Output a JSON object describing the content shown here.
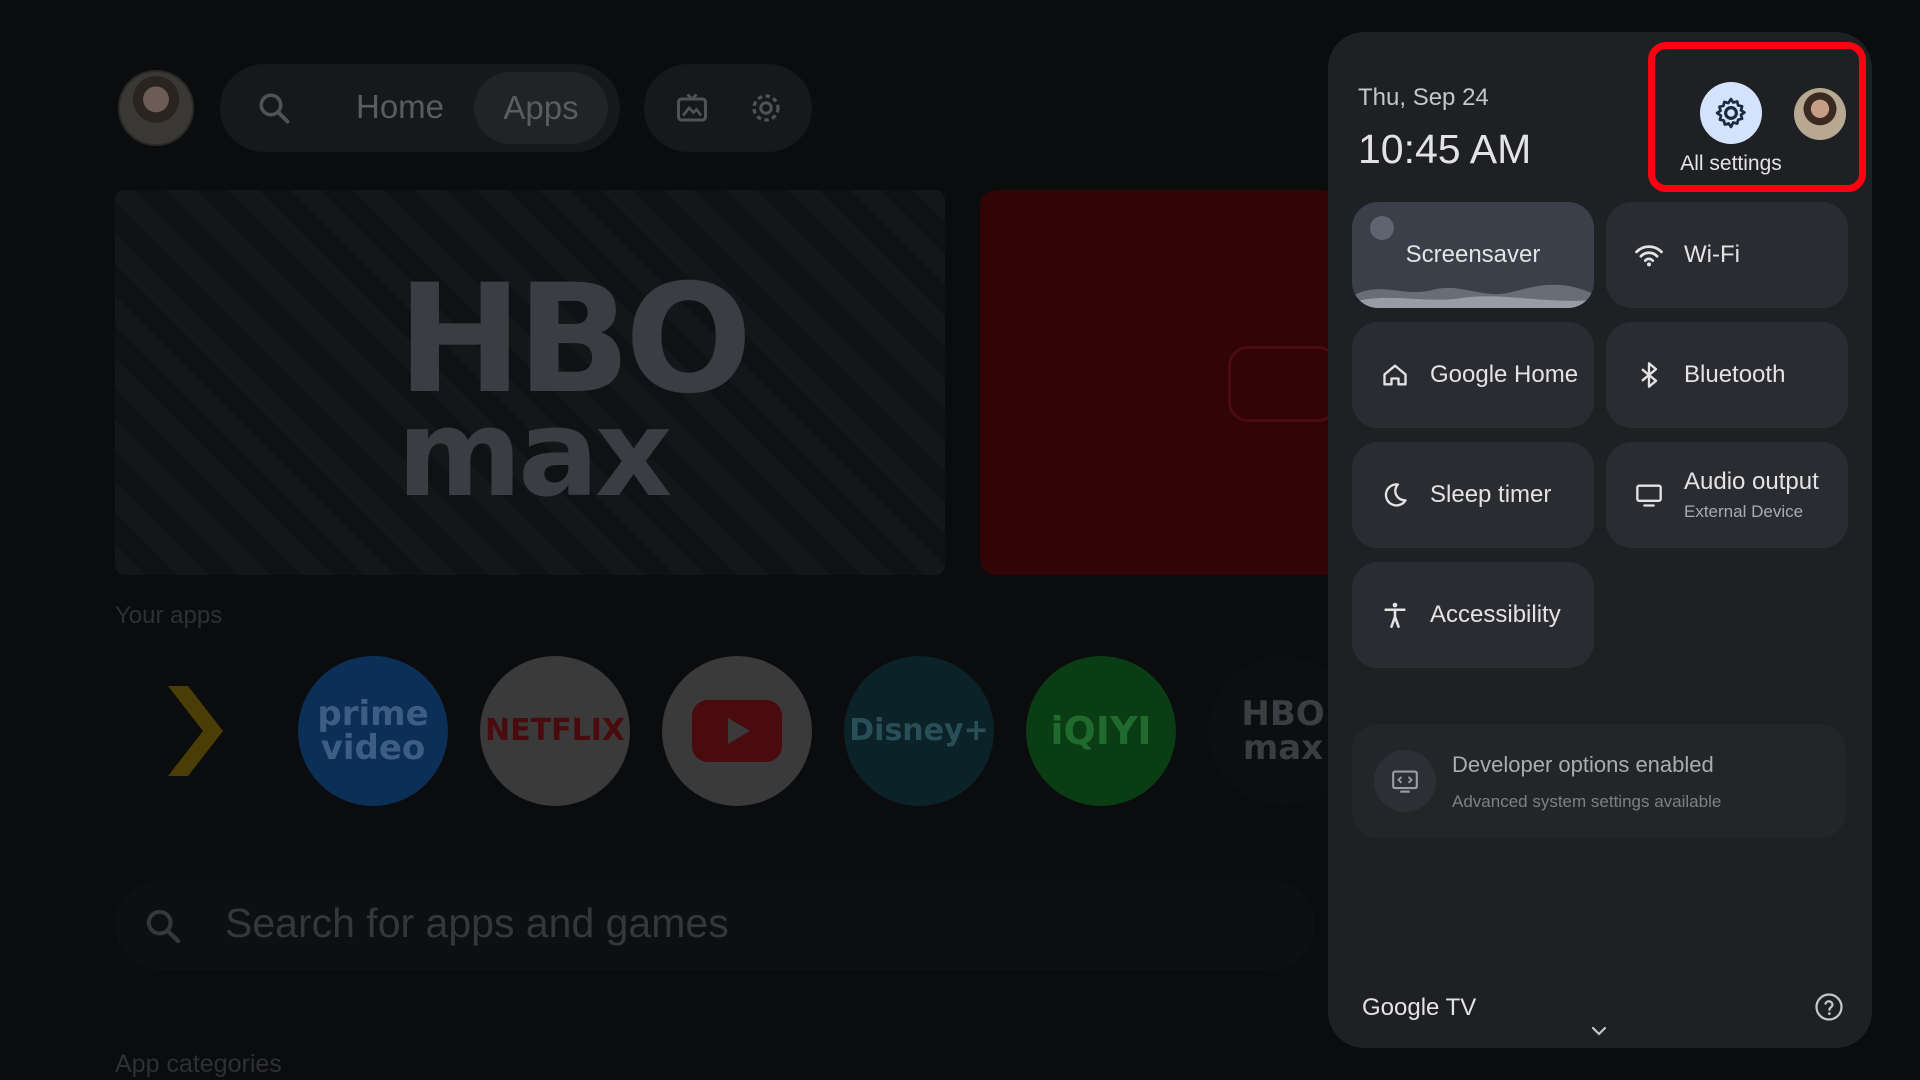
{
  "background": {
    "nav": {
      "home": "Home",
      "apps": "Apps"
    },
    "hero": {
      "logo_line1": "HBO",
      "logo_line2": "max"
    },
    "your_apps_title": "Your apps",
    "apps": [
      {
        "name": "prime video",
        "line1": "prime",
        "line2": "video",
        "color": "#0c2f57",
        "text_color": "#3d5d85"
      },
      {
        "name": "NETFLIX",
        "line1": "NETFLIX",
        "line2": "",
        "color": "#3a3a3a",
        "text_color": "#4a0b0e"
      },
      {
        "name": "YouTube",
        "line1": "",
        "line2": "",
        "color": "#3a3a3a",
        "text_color": "#4a0b0e"
      },
      {
        "name": "Disney+",
        "line1": "Disney+",
        "line2": "",
        "color": "#0b2328",
        "text_color": "#2a4e57"
      },
      {
        "name": "iQIYI",
        "line1": "iQIYI",
        "line2": "",
        "color": "#0b3d14",
        "text_color": "#1f6a2c"
      },
      {
        "name": "HBO max",
        "line1": "HBO",
        "line2": "max",
        "color": "#0d0e10",
        "text_color": "#3b3d42"
      }
    ],
    "search_placeholder": "Search for apps and games",
    "app_categories_title": "App categories"
  },
  "panel": {
    "date": "Thu, Sep 24",
    "time": "10:45 AM",
    "all_settings_label": "All settings",
    "tiles": {
      "screensaver": "Screensaver",
      "wifi": "Wi-Fi",
      "google_home": "Google Home",
      "bluetooth": "Bluetooth",
      "sleep_timer": "Sleep timer",
      "audio_output": "Audio output",
      "audio_output_sub": "External Device",
      "accessibility": "Accessibility"
    },
    "developer": {
      "title": "Developer options enabled",
      "subtitle": "Advanced system settings available"
    },
    "footer": {
      "brand": "Google TV"
    }
  },
  "colors": {
    "highlight": "#ff0010",
    "gear_bg": "#d3e3fd",
    "panel_bg": "#1e2024"
  },
  "icons": [
    "search-icon",
    "photo-frame-icon",
    "gear-icon",
    "wifi-icon",
    "home-icon",
    "bluetooth-icon",
    "moon-icon",
    "monitor-icon",
    "accessibility-icon",
    "developer-icon",
    "chevron-down-icon",
    "help-icon"
  ]
}
